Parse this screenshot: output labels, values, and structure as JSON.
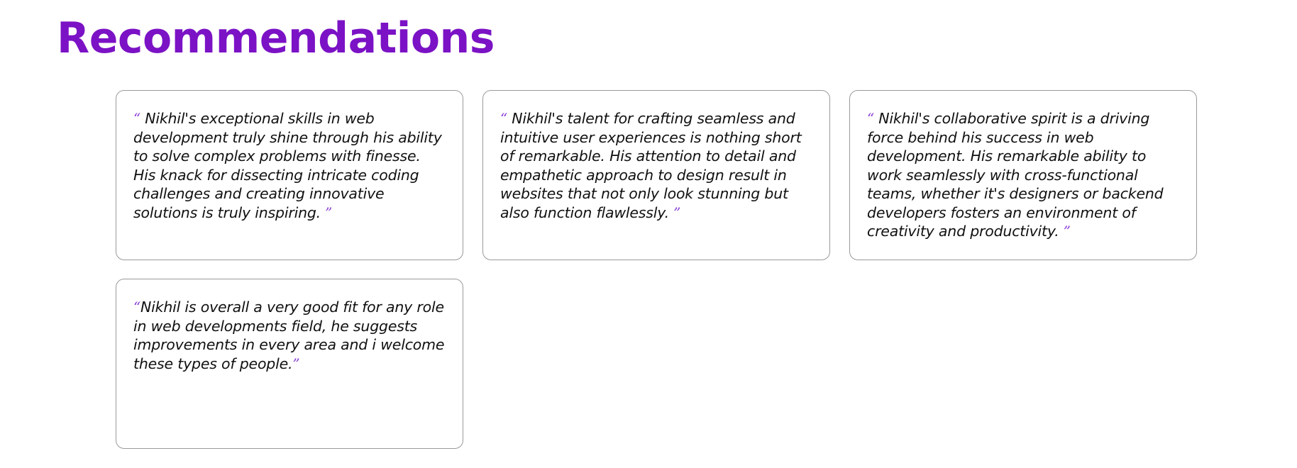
{
  "page": {
    "title": "Recommendations"
  },
  "colors": {
    "accent": "#7b12c5",
    "quote_mark": "#8a3ed6",
    "card_border": "#9a9a9a",
    "text": "#111111"
  },
  "recommendations": [
    {
      "open_mark": "“ ",
      "text": "Nikhil's exceptional skills in web development truly shine through his ability to solve complex problems with finesse. His knack for dissecting intricate coding challenges and creating innovative solutions is truly inspiring.",
      "close_mark": " ”"
    },
    {
      "open_mark": "“ ",
      "text": "Nikhil's talent for crafting seamless and intuitive user experiences is nothing short of remarkable. His attention to detail and empathetic approach to design result in websites that not only look stunning but also function flawlessly.",
      "close_mark": " ”"
    },
    {
      "open_mark": "“ ",
      "text": "Nikhil's collaborative spirit is a driving force behind his success in web development. His remarkable ability to work seamlessly with cross-functional teams, whether it's designers or backend developers fosters an environment of creativity and productivity.",
      "close_mark": " ”"
    },
    {
      "open_mark": "“",
      "text": "Nikhil is overall a very good fit for any role in web developments field, he suggests improvements in every area and i welcome these types of people.",
      "close_mark": "”"
    }
  ]
}
